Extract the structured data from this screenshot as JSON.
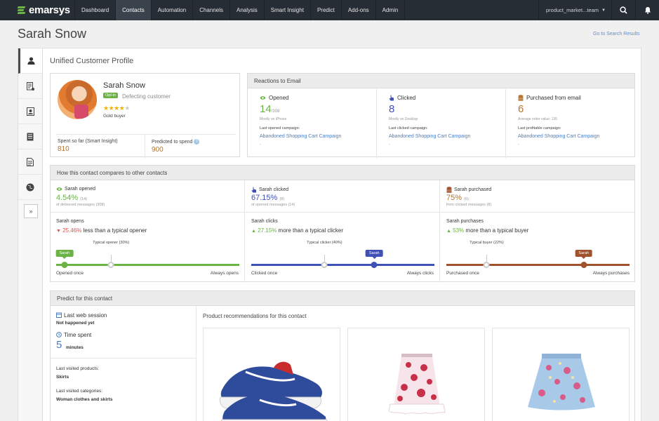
{
  "topbar": {
    "brand": "emarsys",
    "nav": [
      {
        "label": "Dashboard",
        "active": false
      },
      {
        "label": "Contacts",
        "active": true
      },
      {
        "label": "Automation",
        "active": false
      },
      {
        "label": "Channels",
        "active": false
      },
      {
        "label": "Analysis",
        "active": false
      },
      {
        "label": "Smart Insight",
        "active": false
      },
      {
        "label": "Predict",
        "active": false
      },
      {
        "label": "Add-ons",
        "active": false
      },
      {
        "label": "Admin",
        "active": false
      }
    ],
    "user_menu": "product_market...team",
    "icons": [
      "search-icon",
      "bell-icon"
    ]
  },
  "page": {
    "title": "Sarah Snow",
    "goto_link": "Go to Search Results",
    "section_title": "Unified Customer Profile"
  },
  "sidenav": {
    "icons": [
      "user-icon",
      "list-icon",
      "contact-card-icon",
      "document-icon",
      "form-icon",
      "globe-icon"
    ],
    "expand": "»"
  },
  "profile": {
    "name": "Sarah Snow",
    "optin_badge": "Opt-in",
    "segment": "Defecting customer",
    "rating": 4,
    "rating_max": 5,
    "tier": "Gold buyer",
    "spent_label": "Spent so far (Smart Insight)",
    "spent_value": "810",
    "predicted_label": "Predicted to spend",
    "predicted_value": "900"
  },
  "reactions": {
    "title": "Reactions to Email",
    "cols": [
      {
        "label": "Opened",
        "value": "14",
        "suffix": "/308",
        "sub": "Mostly on iPhone",
        "campaign_label": "Last opened campaign:",
        "campaign": "Abandoned Shopping Cart Campaign",
        "color": "#6ab344",
        "icon": "eye-icon"
      },
      {
        "label": "Clicked",
        "value": "8",
        "suffix": "",
        "sub": "Mostly on Desktop",
        "campaign_label": "Last clicked campaign:",
        "campaign": "Abandoned Shopping Cart Campaign",
        "color": "#3f51b5",
        "icon": "click-icon"
      },
      {
        "label": "Purchased from email",
        "value": "6",
        "suffix": "",
        "sub": "Average order value: 135",
        "campaign_label": "Last profitable campaign:",
        "campaign": "Abandoned Shopping Cart Campaign",
        "color": "#b5742f",
        "icon": "coins-icon"
      }
    ]
  },
  "compare": {
    "title": "How this contact compares to other contacts",
    "cols": [
      {
        "top_label": "Sarah opened",
        "pct": "4.54%",
        "count": "(14)",
        "sub": "of delivered messages (308)",
        "name": "Sarah opens",
        "delta": "25.46%",
        "delta_dir": "down",
        "delta_text": "less than a typical opener",
        "typical": "Typical opener (30%)",
        "typical_pos": 0.3,
        "contact_pos": 0.0454,
        "tag": "Sarah",
        "min_label": "Opened once",
        "max_label": "Always opens",
        "color": "#6ab344",
        "icon": "eye-icon"
      },
      {
        "top_label": "Sarah clicked",
        "pct": "67.15%",
        "count": "(8)",
        "sub": "of opened messages (14)",
        "name": "Sarah clicks",
        "delta": "27.15%",
        "delta_dir": "up",
        "delta_text": "more than a typical clicker",
        "typical": "Typical clicker (40%)",
        "typical_pos": 0.4,
        "contact_pos": 0.6715,
        "tag": "Sarah",
        "min_label": "Clicked once",
        "max_label": "Always clicks",
        "color": "#3f51b5",
        "icon": "click-icon"
      },
      {
        "top_label": "Sarah purchased",
        "pct": "75%",
        "count": "(6)",
        "sub": "from clicked messages (8)",
        "name": "Sarah purchases",
        "delta": "53%",
        "delta_dir": "up",
        "delta_text": "more than a typical buyer",
        "typical": "Typical buyer (22%)",
        "typical_pos": 0.22,
        "contact_pos": 0.75,
        "tag": "Sarah",
        "min_label": "Purchased once",
        "max_label": "Always purchases",
        "color": "#a0522d",
        "icon": "coins-icon"
      }
    ]
  },
  "predict": {
    "title": "Predict for this contact",
    "last_session_label": "Last web session",
    "last_session_value": "Not happened yet",
    "time_spent_label": "Time spent",
    "time_spent_value": "5",
    "time_spent_unit": "minutes",
    "last_products_label": "Last visited products:",
    "last_products_value": "Skirts",
    "last_categories_label": "Last visited categories:",
    "last_categories_value": "Woman clothes and skirts",
    "recommendations_title": "Product recommendations for this contact",
    "products": [
      "sneaker-image",
      "floral-skirt-image",
      "blue-floral-skirt-image"
    ]
  }
}
